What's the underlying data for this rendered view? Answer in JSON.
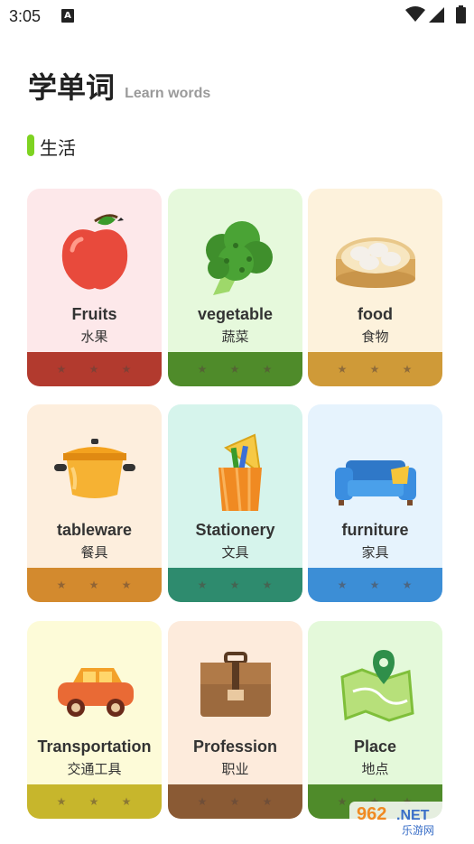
{
  "status_bar": {
    "time": "3:05",
    "notification_letter": "A"
  },
  "header": {
    "title": "学单词",
    "subtitle": "Learn words"
  },
  "section": {
    "title": "生活"
  },
  "categories": [
    {
      "en": "Fruits",
      "zh": "水果",
      "icon": "apple-icon",
      "bg": "#fde8ea",
      "footer": "#b23a2e"
    },
    {
      "en": "vegetable",
      "zh": "蔬菜",
      "icon": "broccoli-icon",
      "bg": "#e6f9dc",
      "footer": "#4f8b2a"
    },
    {
      "en": "food",
      "zh": "食物",
      "icon": "dumpling-steamer-icon",
      "bg": "#fdf2dc",
      "footer": "#cf9a38"
    },
    {
      "en": "tableware",
      "zh": "餐具",
      "icon": "cooking-pot-icon",
      "bg": "#fdeedd",
      "footer": "#d38a2e"
    },
    {
      "en": "Stationery",
      "zh": "文具",
      "icon": "pencil-holder-icon",
      "bg": "#d6f4ec",
      "footer": "#2e8b6e"
    },
    {
      "en": "furniture",
      "zh": "家具",
      "icon": "sofa-icon",
      "bg": "#e6f3fd",
      "footer": "#3c8ed6"
    },
    {
      "en": "Transportation",
      "zh": "交通工具",
      "icon": "car-icon",
      "bg": "#fdfbd8",
      "footer": "#c7b62c"
    },
    {
      "en": "Profession",
      "zh": "职业",
      "icon": "briefcase-icon",
      "bg": "#fdebdc",
      "footer": "#8a5a34"
    },
    {
      "en": "Place",
      "zh": "地点",
      "icon": "map-pin-icon",
      "bg": "#e4f9da",
      "footer": "#4f8b2a"
    }
  ],
  "stars_per_card": 3,
  "watermark": {
    "text_top": "962.NET",
    "text_bottom": "乐游网"
  }
}
